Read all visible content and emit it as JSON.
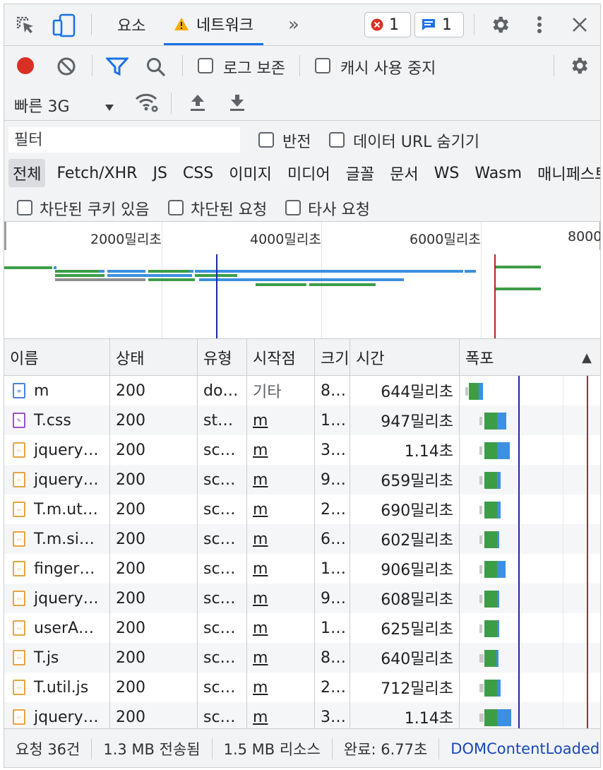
{
  "tabs": {
    "elements": "요소",
    "network": "네트워크",
    "more": "»"
  },
  "badges": {
    "errors": "1",
    "messages": "1"
  },
  "toolbar": {
    "preserve_log": "로그 보존",
    "disable_cache": "캐시 사용 중지",
    "throttling": "빠른 3G"
  },
  "filter": {
    "placeholder": "필터",
    "invert": "반전",
    "hide_data_urls": "데이터 URL 숨기기",
    "types": [
      "전체",
      "Fetch/XHR",
      "JS",
      "CSS",
      "이미지",
      "미디어",
      "글꼴",
      "문서",
      "WS",
      "Wasm",
      "매니페스트"
    ],
    "selected_type": "전체",
    "blocked_cookies": "차단된 쿠키 있음",
    "blocked_requests": "차단된 요청",
    "third_party": "타사 요청"
  },
  "overview": {
    "ticks": [
      "2000밀리초",
      "4000밀리초",
      "6000밀리초",
      "8000"
    ]
  },
  "columns": {
    "name": "이름",
    "status": "상태",
    "type": "유형",
    "initiator": "시작점",
    "size": "크기",
    "time": "시간",
    "waterfall": "폭포",
    "sort_arrow": "▲"
  },
  "rows": [
    {
      "icon": "doc",
      "name": "m",
      "status": "200",
      "type": "do…",
      "initiator": "기타",
      "size": "8…",
      "time": "644밀리초"
    },
    {
      "icon": "css",
      "name": "T.css",
      "status": "200",
      "type": "st…",
      "initiator": "m",
      "size": "1…",
      "time": "947밀리초"
    },
    {
      "icon": "script",
      "name": "jquery…",
      "status": "200",
      "type": "sc…",
      "initiator": "m",
      "size": "3…",
      "time": "1.14초"
    },
    {
      "icon": "script",
      "name": "jquery…",
      "status": "200",
      "type": "sc…",
      "initiator": "m",
      "size": "9…",
      "time": "659밀리초"
    },
    {
      "icon": "script",
      "name": "T.m.ut…",
      "status": "200",
      "type": "sc…",
      "initiator": "m",
      "size": "2…",
      "time": "690밀리초"
    },
    {
      "icon": "script",
      "name": "T.m.si…",
      "status": "200",
      "type": "sc…",
      "initiator": "m",
      "size": "6…",
      "time": "602밀리초"
    },
    {
      "icon": "script",
      "name": "finger…",
      "status": "200",
      "type": "sc…",
      "initiator": "m",
      "size": "1…",
      "time": "906밀리초"
    },
    {
      "icon": "script",
      "name": "jquery…",
      "status": "200",
      "type": "sc…",
      "initiator": "m",
      "size": "9…",
      "time": "608밀리초"
    },
    {
      "icon": "script",
      "name": "userA…",
      "status": "200",
      "type": "sc…",
      "initiator": "m",
      "size": "1…",
      "time": "625밀리초"
    },
    {
      "icon": "script",
      "name": "T.js",
      "status": "200",
      "type": "sc…",
      "initiator": "m",
      "size": "8…",
      "time": "640밀리초"
    },
    {
      "icon": "script",
      "name": "T.util.js",
      "status": "200",
      "type": "sc…",
      "initiator": "m",
      "size": "2…",
      "time": "712밀리초"
    },
    {
      "icon": "script",
      "name": "jquery…",
      "status": "200",
      "type": "sc…",
      "initiator": "m",
      "size": "3…",
      "time": "1.14초"
    }
  ],
  "status": {
    "requests": "요청 36건",
    "transferred": "1.3 MB 전송됨",
    "resources": "1.5 MB 리소스",
    "finish": "완료: 6.77초",
    "domcontent": "DOMContentLoaded"
  },
  "colors": {
    "accent": "#1a73e8",
    "record": "#d93025",
    "waiting": "#3d9d47",
    "download": "#3d8fe0",
    "domcontent_line": "#1a2a9c",
    "load_line": "#b3261e"
  }
}
